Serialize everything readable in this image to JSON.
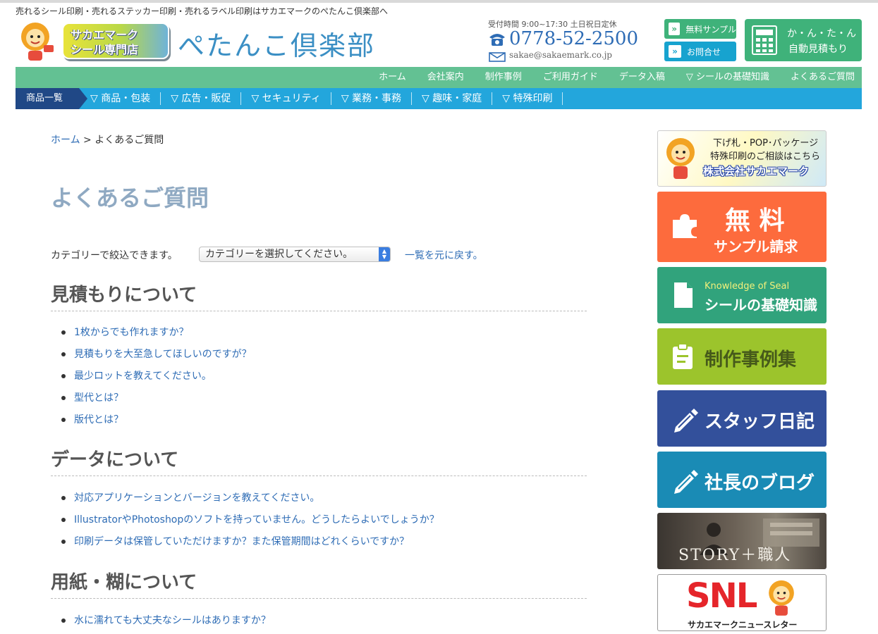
{
  "header": {
    "tagline": "売れるシール印刷・売れるステッカー印刷・売れるラベル印刷はサカエマークのぺたんこ倶楽部へ",
    "badge_line1": "サカエマーク",
    "badge_line2": "シール専門店",
    "brand": "ぺたんこ倶楽部",
    "hours": "受付時間 9:00~17:30 土日祝日定休",
    "phone": "0778-52-2500",
    "email": "sakae@sakaemark.co.jp",
    "sample_button": "無料サンプル",
    "contact_button": "お問合せ",
    "estimate_line1": "か・ん・た・ん",
    "estimate_line2": "自動見積もり"
  },
  "global_nav": [
    "ホーム",
    "会社案内",
    "制作事例",
    "ご利用ガイド",
    "データ入稿",
    "▽ シールの基礎知識",
    "よくあるご質問"
  ],
  "category_nav": {
    "first": "商品一覧",
    "items": [
      "▽ 商品・包装",
      "▽ 広告・販促",
      "▽ セキュリティ",
      "▽ 業務・事務",
      "▽ 趣味・家庭",
      "▽ 特殊印刷"
    ]
  },
  "breadcrumb": {
    "home": "ホーム",
    "sep": " > ",
    "current": "よくあるご質問"
  },
  "page_title": "よくあるご質問",
  "filter": {
    "label": "カテゴリーで絞込できます。",
    "select_value": "カテゴリーを選択してください。",
    "reset": "一覧を元に戻す。"
  },
  "sections": [
    {
      "title": "見積もりについて",
      "items": [
        "1枚からでも作れますか？",
        "見積もりを大至急してほしいのですが？",
        "最少ロットを教えてください。",
        "型代とは？",
        "版代とは？"
      ]
    },
    {
      "title": "データについて",
      "items": [
        "対応アプリケーションとバージョンを教えてください。",
        "IllustratorやPhotoshopのソフトを持っていません。どうしたらよいでしょうか？",
        "印刷データは保管していただけますか？また保管期間はどれくらいですか？"
      ]
    },
    {
      "title": "用紙・糊について",
      "items": [
        "水に濡れても大丈夫なシールはありますか？"
      ]
    }
  ],
  "sidebar": {
    "banner_line1": "下げ札・POP･パッケージ",
    "banner_line2": "特殊印刷のご相談はこちら",
    "banner_company": "株式会社サカエマーク",
    "free_line1": "無 料",
    "free_line2": "サンプル請求",
    "knowledge_en": "Knowledge of Seal",
    "knowledge_ja": "シールの基礎知識",
    "works": "制作事例集",
    "staff": "スタッフ日記",
    "president": "社長のブログ",
    "story": "STORY＋職人",
    "snl_logo": "SNL",
    "snl_caption": "サカエマークニュースレター"
  },
  "colors": {
    "green": "#63c193",
    "blue": "#23a6dc",
    "navy": "#204886",
    "link": "#2e6cb5",
    "free": "#fd6b3d",
    "knowledge": "#31a37c",
    "works": "#9cc42c",
    "staff": "#33509b",
    "president": "#1a8bb5"
  }
}
